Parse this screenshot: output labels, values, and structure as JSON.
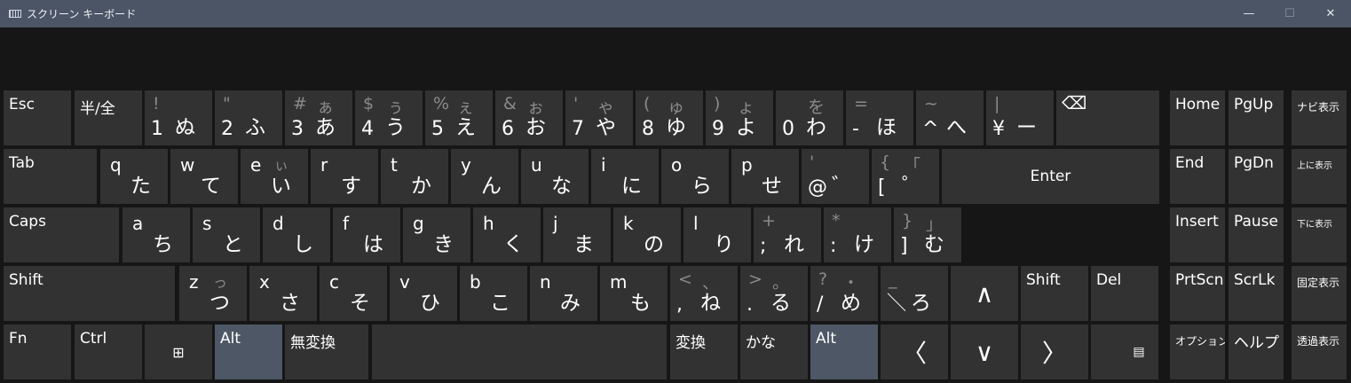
{
  "window": {
    "title": "スクリーン キーボード",
    "minimize": "—",
    "maximize": "☐",
    "close": "✕"
  },
  "row1": [
    {
      "label": "Esc"
    },
    {
      "label": "半/全"
    },
    {
      "shift": "!",
      "main": "1",
      "kana": "ぬ"
    },
    {
      "shift": "\"",
      "main": "2",
      "kana": "ふ"
    },
    {
      "shift": "#",
      "kshift": "ぁ",
      "main": "3",
      "kana": "あ"
    },
    {
      "shift": "$",
      "kshift": "ぅ",
      "main": "4",
      "kana": "う"
    },
    {
      "shift": "%",
      "kshift": "ぇ",
      "main": "5",
      "kana": "え"
    },
    {
      "shift": "&",
      "kshift": "ぉ",
      "main": "6",
      "kana": "お"
    },
    {
      "shift": "'",
      "kshift": "ゃ",
      "main": "7",
      "kana": "や"
    },
    {
      "shift": "(",
      "kshift": "ゅ",
      "main": "8",
      "kana": "ゆ"
    },
    {
      "shift": ")",
      "kshift": "ょ",
      "main": "9",
      "kana": "よ"
    },
    {
      "shift": "",
      "kshift": "を",
      "main": "0",
      "kana": "わ"
    },
    {
      "shift": "=",
      "main": "-",
      "kana": "ほ"
    },
    {
      "shift": "~",
      "main": "^",
      "kana": "へ"
    },
    {
      "shift": "|",
      "main": "¥",
      "kana": "ー"
    },
    {
      "icon": "⌫"
    }
  ],
  "row2": [
    {
      "label": "Tab"
    },
    {
      "latin": "q",
      "kana": "た"
    },
    {
      "latin": "w",
      "kana": "て"
    },
    {
      "latin": "e",
      "ksmall": "ぃ",
      "kana": "い"
    },
    {
      "latin": "r",
      "kana": "す"
    },
    {
      "latin": "t",
      "kana": "か"
    },
    {
      "latin": "y",
      "kana": "ん"
    },
    {
      "latin": "u",
      "kana": "な"
    },
    {
      "latin": "i",
      "kana": "に"
    },
    {
      "latin": "o",
      "kana": "ら"
    },
    {
      "latin": "p",
      "kana": "せ"
    },
    {
      "shift": "'",
      "main": "@",
      "kana": "゛"
    },
    {
      "shift": "{",
      "kshift": "「",
      "main": "[",
      "kana": "゜"
    },
    {
      "label": "Enter"
    }
  ],
  "row3": [
    {
      "label": "Caps"
    },
    {
      "latin": "a",
      "kana": "ち"
    },
    {
      "latin": "s",
      "kana": "と"
    },
    {
      "latin": "d",
      "kana": "し"
    },
    {
      "latin": "f",
      "kana": "は"
    },
    {
      "latin": "g",
      "kana": "き"
    },
    {
      "latin": "h",
      "kana": "く"
    },
    {
      "latin": "j",
      "kana": "ま"
    },
    {
      "latin": "k",
      "kana": "の"
    },
    {
      "latin": "l",
      "kana": "り"
    },
    {
      "shift": "+",
      "main": ";",
      "kana": "れ"
    },
    {
      "shift": "*",
      "main": ":",
      "kana": "け"
    },
    {
      "shift": "}",
      "kshift": "」",
      "main": "]",
      "kana": "む"
    }
  ],
  "row4": [
    {
      "label": "Shift"
    },
    {
      "latin": "z",
      "ksmall": "っ",
      "kana": "つ"
    },
    {
      "latin": "x",
      "kana": "さ"
    },
    {
      "latin": "c",
      "kana": "そ"
    },
    {
      "latin": "v",
      "kana": "ひ"
    },
    {
      "latin": "b",
      "kana": "こ"
    },
    {
      "latin": "n",
      "kana": "み"
    },
    {
      "latin": "m",
      "kana": "も"
    },
    {
      "shift": "<",
      "kshift": "、",
      "main": ",",
      "kana": "ね"
    },
    {
      "shift": ">",
      "kshift": "。",
      "main": ".",
      "kana": "る"
    },
    {
      "shift": "?",
      "kshift": "・",
      "main": "/",
      "kana": "め"
    },
    {
      "shift": "_",
      "main": "＼",
      "kana": "ろ"
    },
    {
      "icon": "∧"
    },
    {
      "label": "Shift"
    },
    {
      "label": "Del"
    }
  ],
  "row5": [
    {
      "label": "Fn"
    },
    {
      "label": "Ctrl"
    },
    {
      "icon": "⊞"
    },
    {
      "label": "Alt"
    },
    {
      "label": "無変換"
    },
    {
      "label": ""
    },
    {
      "label": "変換"
    },
    {
      "label": "かな"
    },
    {
      "label": "Alt"
    },
    {
      "icon": "〈"
    },
    {
      "icon": "∨"
    },
    {
      "icon": "〉"
    },
    {
      "icon": "▤"
    }
  ],
  "nav": [
    [
      "Home",
      "PgUp",
      "ナビ表示"
    ],
    [
      "End",
      "PgDn",
      "上に表示"
    ],
    [
      "Insert",
      "Pause",
      "下に表示"
    ],
    [
      "PrtScn",
      "ScrLk",
      "固定表示"
    ],
    [
      "オプション",
      "ヘルプ",
      "透過表示"
    ]
  ]
}
